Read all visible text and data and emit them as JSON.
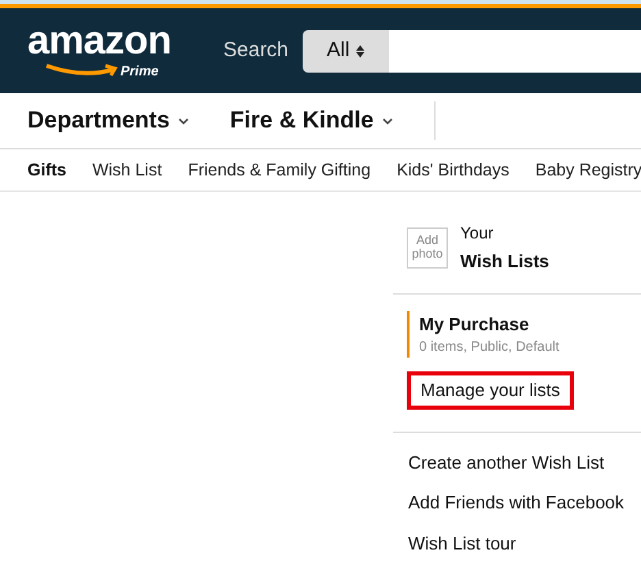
{
  "header": {
    "logo": {
      "wordmark": "amazon",
      "tier": "Prime"
    },
    "search": {
      "label": "Search",
      "scope": "All"
    }
  },
  "nav": [
    {
      "label": "Departments"
    },
    {
      "label": "Fire & Kindle"
    }
  ],
  "subnav": [
    {
      "label": "Gifts",
      "selected": true
    },
    {
      "label": "Wish List",
      "selected": false
    },
    {
      "label": "Friends & Family Gifting",
      "selected": false
    },
    {
      "label": "Kids' Birthdays",
      "selected": false
    },
    {
      "label": "Baby Registry",
      "selected": false
    }
  ],
  "sidebar": {
    "photo": "Add photo",
    "title_top": "Your",
    "title": "Wish Lists",
    "lists": [
      {
        "name": "My Purchase",
        "meta": "0 items, Public, Default",
        "selected": true
      }
    ],
    "manage": {
      "label": "Manage your lists",
      "highlighted": true
    },
    "links": [
      "Create another Wish List",
      "Add Friends with Facebook",
      "Wish List tour"
    ]
  }
}
